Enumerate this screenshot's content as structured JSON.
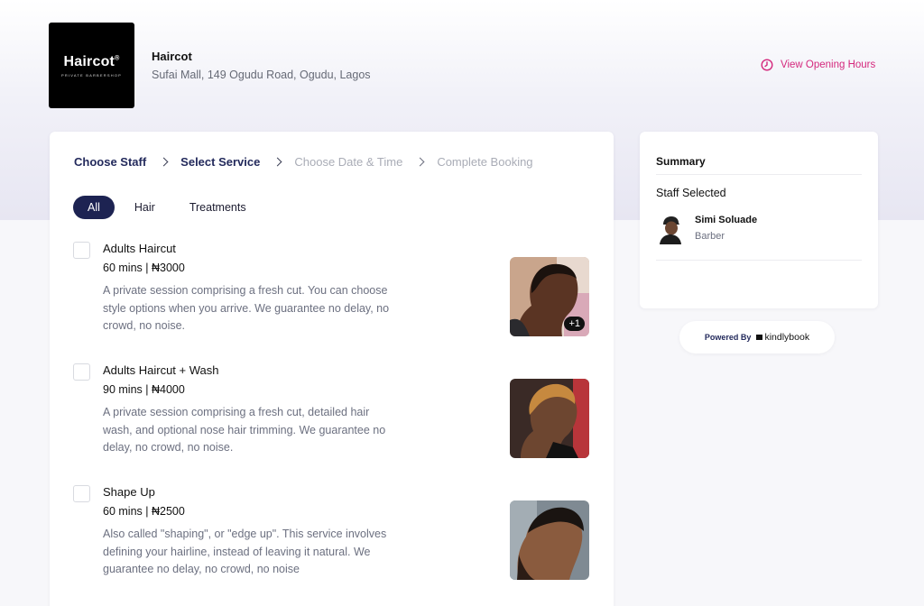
{
  "business": {
    "logo_text": "Haircot",
    "logo_mark": "®",
    "logo_tagline": "PRIVATE BARBERSHOP",
    "name": "Haircot",
    "address": "Sufai Mall, 149 Ogudu Road, Ogudu, Lagos",
    "hours_link": "View Opening Hours",
    "accent_color": "#d4287d"
  },
  "steps": [
    {
      "label": "Choose Staff",
      "state": "done"
    },
    {
      "label": "Select Service",
      "state": "current"
    },
    {
      "label": "Choose Date & Time",
      "state": "pending"
    },
    {
      "label": "Complete Booking",
      "state": "pending"
    }
  ],
  "filters": [
    {
      "label": "All",
      "selected": true
    },
    {
      "label": "Hair",
      "selected": false
    },
    {
      "label": "Treatments",
      "selected": false
    }
  ],
  "services": [
    {
      "title": "Adults Haircut",
      "price": "60 mins | ₦3000",
      "description": "A private session comprising a fresh cut. You can choose style options when you arrive. We guarantee no delay, no crowd, no noise.",
      "extra_images": "+1",
      "checked": false
    },
    {
      "title": "Adults Haircut + Wash",
      "price": "90 mins | ₦4000",
      "description": "A private session comprising a fresh cut, detailed hair wash, and optional nose hair trimming. We guarantee no delay, no crowd, no noise.",
      "checked": false
    },
    {
      "title": "Shape Up",
      "price": "60 mins | ₦2500",
      "description": "Also called \"shaping\", or \"edge up\". This service involves defining your hairline, instead of leaving it natural. We guarantee no delay, no crowd, no noise",
      "checked": false
    }
  ],
  "summary": {
    "title": "Summary",
    "staff_label": "Staff Selected",
    "staff_name": "Simi Soluade",
    "staff_role": "Barber"
  },
  "footer": {
    "powered_by": "Powered By",
    "brand": "kindlybook"
  },
  "colors": {
    "primary": "#1d2352",
    "muted": "#a9acb6"
  }
}
